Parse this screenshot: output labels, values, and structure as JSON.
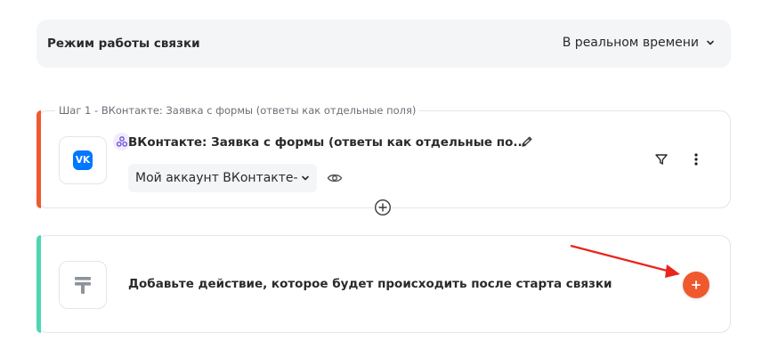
{
  "mode": {
    "title": "Режим работы связки",
    "selected": "В реальном времени"
  },
  "step1": {
    "legend": "Шаг 1 - ВКонтакте: Заявка с формы (ответы как отдельные поля)",
    "title": "ВКонтакте: Заявка с формы (ответы как отдельные по...",
    "app_icon_text": "VK",
    "account": "Мой аккаунт ВКонтакте-",
    "accent_color": "#f0592e"
  },
  "action": {
    "text": "Добавьте действие, которое будет происходить после старта связки",
    "accent_color": "#4fd5b5"
  },
  "icons": {
    "mode_chevron": "chevron-down-icon",
    "webhook": "webhook-icon",
    "edit": "pencil-icon",
    "account_chevron": "chevron-down-icon",
    "eye": "eye-icon",
    "filter": "filter-icon",
    "more": "more-vertical-icon",
    "add_step": "plus-circle-icon",
    "action_placeholder": "action-placeholder-icon",
    "add_action": "plus-icon",
    "annotation": "red-arrow-annotation"
  },
  "colors": {
    "brand_orange": "#f0592e",
    "vk_blue": "#0077ff",
    "teal_accent": "#4fd5b5",
    "annotation_red": "#e8261c"
  }
}
